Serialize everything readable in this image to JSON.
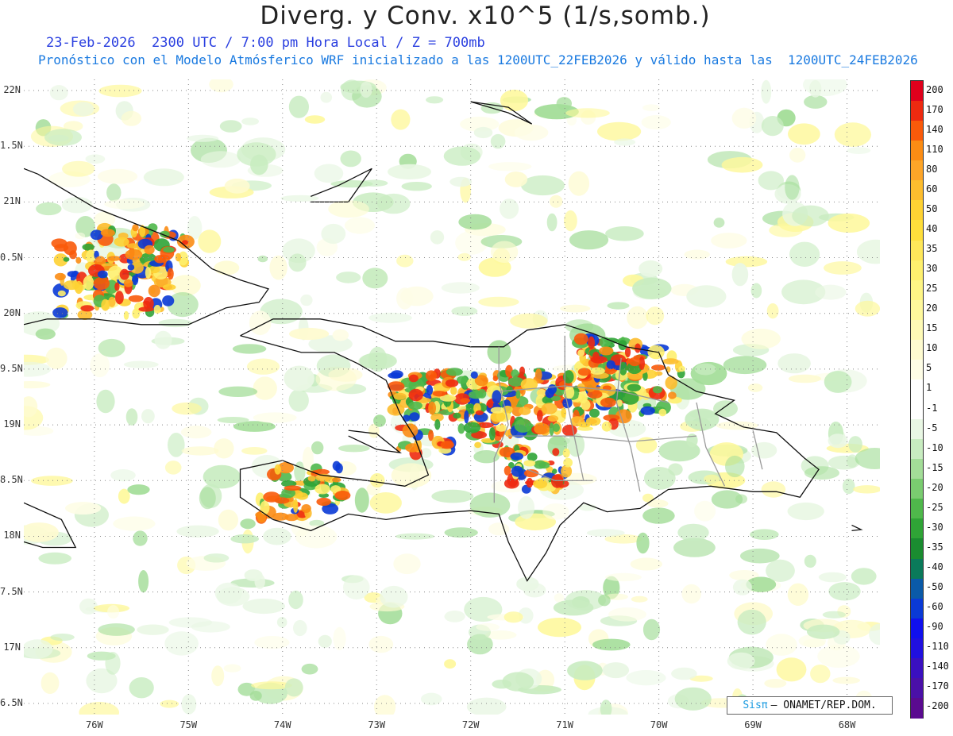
{
  "title": "Diverg. y Conv. x10^5 (1/s,somb.)",
  "subtitle1": "23-Feb-2026  2300 UTC / 7:00 pm Hora Local / Z = 700mb",
  "subtitle2": "Pronóstico con el Modelo Atmósferico WRF inicializado a las 1200UTC_22FEB2026 y válido hasta las  1200UTC_24FEB2026",
  "credit": {
    "logo": "Sisπ",
    "text": "– ONAMET/REP.DOM."
  },
  "colors": {
    "subtitle1": "#2a3fe0",
    "subtitle2": "#1a7ae0",
    "land_outline": "#111111",
    "province_lines": "#999999"
  },
  "map": {
    "lon_range": [
      -76.75,
      -67.65
    ],
    "lat_range": [
      16.4,
      22.1
    ],
    "lat_ticks": [
      {
        "value": 22.0,
        "label": "22N"
      },
      {
        "value": 21.5,
        "label": "1.5N"
      },
      {
        "value": 21.0,
        "label": "21N"
      },
      {
        "value": 20.5,
        "label": "0.5N"
      },
      {
        "value": 20.0,
        "label": "20N"
      },
      {
        "value": 19.5,
        "label": "9.5N"
      },
      {
        "value": 19.0,
        "label": "19N"
      },
      {
        "value": 18.5,
        "label": "8.5N"
      },
      {
        "value": 18.0,
        "label": "18N"
      },
      {
        "value": 17.5,
        "label": "7.5N"
      },
      {
        "value": 17.0,
        "label": "17N"
      },
      {
        "value": 16.5,
        "label": "6.5N"
      }
    ],
    "lon_ticks": [
      {
        "value": -76,
        "label": "76W"
      },
      {
        "value": -75,
        "label": "75W"
      },
      {
        "value": -74,
        "label": "74W"
      },
      {
        "value": -73,
        "label": "73W"
      },
      {
        "value": -72,
        "label": "72W"
      },
      {
        "value": -71,
        "label": "71W"
      },
      {
        "value": -70,
        "label": "70W"
      },
      {
        "value": -69,
        "label": "69W"
      },
      {
        "value": -68,
        "label": "68W"
      }
    ],
    "gridlines": true
  },
  "colorbar": {
    "labels": [
      "200",
      "170",
      "140",
      "110",
      "80",
      "60",
      "50",
      "40",
      "35",
      "30",
      "25",
      "20",
      "15",
      "10",
      "5",
      "1",
      "-1",
      "-5",
      "-10",
      "-15",
      "-20",
      "-25",
      "-30",
      "-35",
      "-40",
      "-50",
      "-60",
      "-90",
      "-110",
      "-140",
      "-170",
      "-200"
    ],
    "colors": [
      "#e0001c",
      "#ee2a10",
      "#fa5a0a",
      "#fb8c14",
      "#fda528",
      "#fdbd2e",
      "#fed233",
      "#fede3b",
      "#fee75a",
      "#fef06e",
      "#fef585",
      "#fef89c",
      "#fefab6",
      "#fefbd0",
      "#fefde6",
      "#ffffff",
      "#ffffff",
      "#e9f7e4",
      "#c8ecc0",
      "#a3dd98",
      "#7acc70",
      "#4fb84b",
      "#2fa436",
      "#1a8c30",
      "#0a7a5a",
      "#0a5aa8",
      "#0a3ad6",
      "#1010ee",
      "#2010e0",
      "#3a10c0",
      "#4a10a8",
      "#5a0a90"
    ]
  }
}
